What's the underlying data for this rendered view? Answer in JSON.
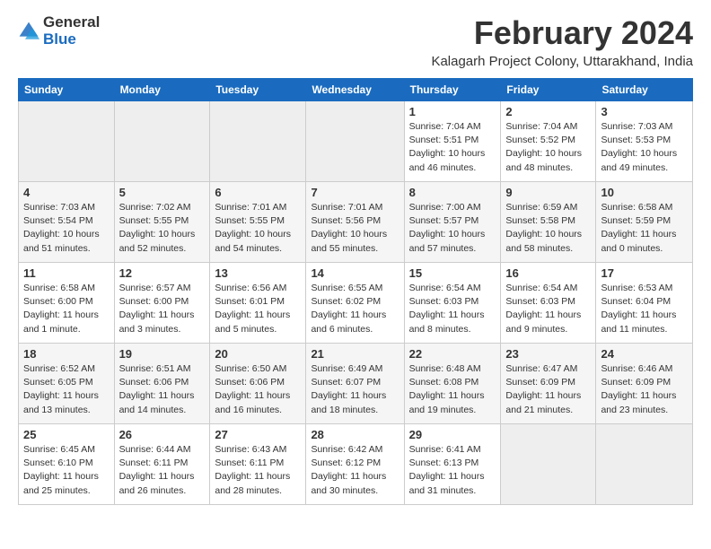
{
  "header": {
    "logo_general": "General",
    "logo_blue": "Blue",
    "main_title": "February 2024",
    "subtitle": "Kalagarh Project Colony, Uttarakhand, India"
  },
  "days_header": [
    "Sunday",
    "Monday",
    "Tuesday",
    "Wednesday",
    "Thursday",
    "Friday",
    "Saturday"
  ],
  "weeks": [
    {
      "days": [
        {
          "num": "",
          "info": ""
        },
        {
          "num": "",
          "info": ""
        },
        {
          "num": "",
          "info": ""
        },
        {
          "num": "",
          "info": ""
        },
        {
          "num": "1",
          "info": "Sunrise: 7:04 AM\nSunset: 5:51 PM\nDaylight: 10 hours\nand 46 minutes."
        },
        {
          "num": "2",
          "info": "Sunrise: 7:04 AM\nSunset: 5:52 PM\nDaylight: 10 hours\nand 48 minutes."
        },
        {
          "num": "3",
          "info": "Sunrise: 7:03 AM\nSunset: 5:53 PM\nDaylight: 10 hours\nand 49 minutes."
        }
      ]
    },
    {
      "days": [
        {
          "num": "4",
          "info": "Sunrise: 7:03 AM\nSunset: 5:54 PM\nDaylight: 10 hours\nand 51 minutes."
        },
        {
          "num": "5",
          "info": "Sunrise: 7:02 AM\nSunset: 5:55 PM\nDaylight: 10 hours\nand 52 minutes."
        },
        {
          "num": "6",
          "info": "Sunrise: 7:01 AM\nSunset: 5:55 PM\nDaylight: 10 hours\nand 54 minutes."
        },
        {
          "num": "7",
          "info": "Sunrise: 7:01 AM\nSunset: 5:56 PM\nDaylight: 10 hours\nand 55 minutes."
        },
        {
          "num": "8",
          "info": "Sunrise: 7:00 AM\nSunset: 5:57 PM\nDaylight: 10 hours\nand 57 minutes."
        },
        {
          "num": "9",
          "info": "Sunrise: 6:59 AM\nSunset: 5:58 PM\nDaylight: 10 hours\nand 58 minutes."
        },
        {
          "num": "10",
          "info": "Sunrise: 6:58 AM\nSunset: 5:59 PM\nDaylight: 11 hours\nand 0 minutes."
        }
      ]
    },
    {
      "days": [
        {
          "num": "11",
          "info": "Sunrise: 6:58 AM\nSunset: 6:00 PM\nDaylight: 11 hours\nand 1 minute."
        },
        {
          "num": "12",
          "info": "Sunrise: 6:57 AM\nSunset: 6:00 PM\nDaylight: 11 hours\nand 3 minutes."
        },
        {
          "num": "13",
          "info": "Sunrise: 6:56 AM\nSunset: 6:01 PM\nDaylight: 11 hours\nand 5 minutes."
        },
        {
          "num": "14",
          "info": "Sunrise: 6:55 AM\nSunset: 6:02 PM\nDaylight: 11 hours\nand 6 minutes."
        },
        {
          "num": "15",
          "info": "Sunrise: 6:54 AM\nSunset: 6:03 PM\nDaylight: 11 hours\nand 8 minutes."
        },
        {
          "num": "16",
          "info": "Sunrise: 6:54 AM\nSunset: 6:03 PM\nDaylight: 11 hours\nand 9 minutes."
        },
        {
          "num": "17",
          "info": "Sunrise: 6:53 AM\nSunset: 6:04 PM\nDaylight: 11 hours\nand 11 minutes."
        }
      ]
    },
    {
      "days": [
        {
          "num": "18",
          "info": "Sunrise: 6:52 AM\nSunset: 6:05 PM\nDaylight: 11 hours\nand 13 minutes."
        },
        {
          "num": "19",
          "info": "Sunrise: 6:51 AM\nSunset: 6:06 PM\nDaylight: 11 hours\nand 14 minutes."
        },
        {
          "num": "20",
          "info": "Sunrise: 6:50 AM\nSunset: 6:06 PM\nDaylight: 11 hours\nand 16 minutes."
        },
        {
          "num": "21",
          "info": "Sunrise: 6:49 AM\nSunset: 6:07 PM\nDaylight: 11 hours\nand 18 minutes."
        },
        {
          "num": "22",
          "info": "Sunrise: 6:48 AM\nSunset: 6:08 PM\nDaylight: 11 hours\nand 19 minutes."
        },
        {
          "num": "23",
          "info": "Sunrise: 6:47 AM\nSunset: 6:09 PM\nDaylight: 11 hours\nand 21 minutes."
        },
        {
          "num": "24",
          "info": "Sunrise: 6:46 AM\nSunset: 6:09 PM\nDaylight: 11 hours\nand 23 minutes."
        }
      ]
    },
    {
      "days": [
        {
          "num": "25",
          "info": "Sunrise: 6:45 AM\nSunset: 6:10 PM\nDaylight: 11 hours\nand 25 minutes."
        },
        {
          "num": "26",
          "info": "Sunrise: 6:44 AM\nSunset: 6:11 PM\nDaylight: 11 hours\nand 26 minutes."
        },
        {
          "num": "27",
          "info": "Sunrise: 6:43 AM\nSunset: 6:11 PM\nDaylight: 11 hours\nand 28 minutes."
        },
        {
          "num": "28",
          "info": "Sunrise: 6:42 AM\nSunset: 6:12 PM\nDaylight: 11 hours\nand 30 minutes."
        },
        {
          "num": "29",
          "info": "Sunrise: 6:41 AM\nSunset: 6:13 PM\nDaylight: 11 hours\nand 31 minutes."
        },
        {
          "num": "",
          "info": ""
        },
        {
          "num": "",
          "info": ""
        }
      ]
    }
  ]
}
